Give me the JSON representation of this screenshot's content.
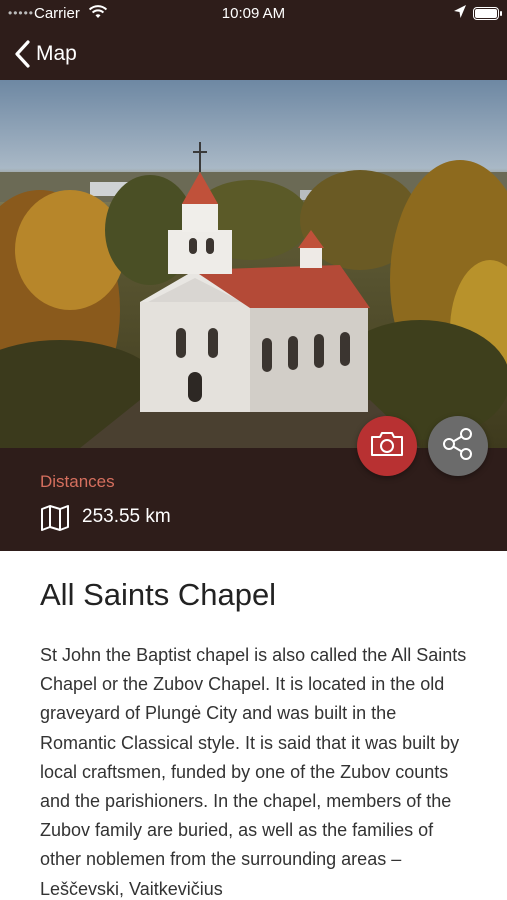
{
  "status_bar": {
    "carrier": "Carrier",
    "time": "10:09 AM",
    "icons": [
      "signal-dots-icon",
      "wifi-icon",
      "location-arrow-icon",
      "battery-icon"
    ]
  },
  "nav": {
    "back_label": "Map",
    "back_icon": "chevron-left-icon"
  },
  "hero": {
    "image": "photo-chapel-autumn-trees",
    "buttons": [
      {
        "name": "camera-button",
        "icon": "camera-icon",
        "color": "#b83132"
      },
      {
        "name": "share-button",
        "icon": "share-icon",
        "color": "#6b6b6b"
      }
    ]
  },
  "distances": {
    "label": "Distances",
    "value": "253.55 km",
    "icon": "map-icon"
  },
  "article": {
    "title": "All Saints Chapel",
    "body": "St John the Baptist chapel is also called the All Saints Chapel or the Zubov Chapel. It is located in the old graveyard of Plungė City and was built in the Romantic Classical style. It is said that it was built by local craftsmen, funded by one of the Zubov counts and the parishioners. In the chapel, members of the Zubov family are buried, as well as the families of other noblemen from the surrounding areas – Leščevski, Vaitkevičius"
  },
  "colors": {
    "header_bg": "#2e1d1a",
    "accent": "#d56f5e",
    "camera_button": "#b83132",
    "share_button": "#6b6b6b"
  }
}
